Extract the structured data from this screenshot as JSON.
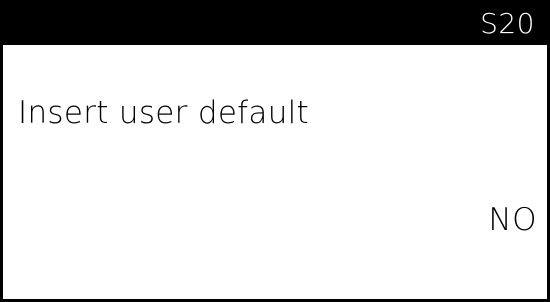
{
  "header": {
    "screen_code": "S20"
  },
  "setting": {
    "label": "Insert user default",
    "value": "NO"
  },
  "colors": {
    "header_background": "#000000",
    "header_text": "#ffffff",
    "screen_background": "#ffffff",
    "text": "#000000",
    "border": "#000000"
  }
}
